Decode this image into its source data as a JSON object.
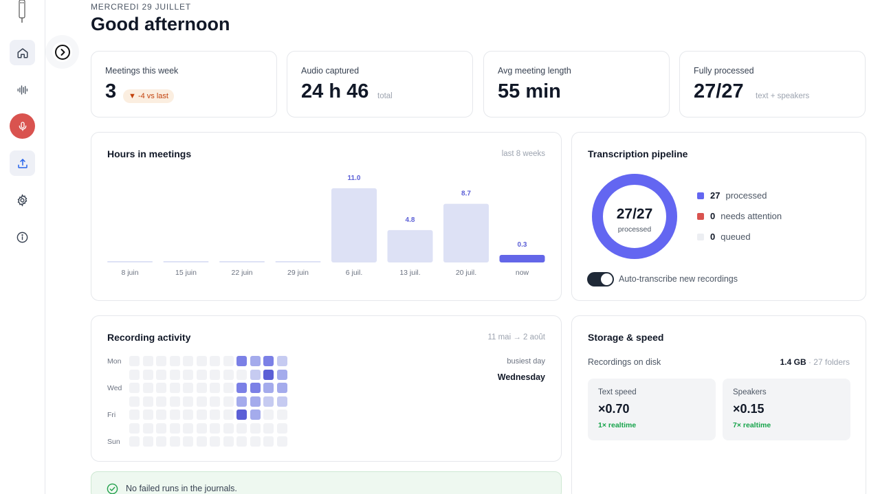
{
  "header": {
    "date": "MERCREDI 29 JUILLET",
    "greeting": "Good afternoon"
  },
  "sidebar": {
    "items": [
      {
        "icon": "home-icon"
      },
      {
        "icon": "waveform-icon"
      },
      {
        "icon": "microphone-icon"
      },
      {
        "icon": "upload-icon"
      },
      {
        "icon": "gear-icon"
      },
      {
        "icon": "info-icon"
      }
    ]
  },
  "stats": [
    {
      "label": "Meetings this week",
      "value": "3",
      "badge": "▼ -4 vs last"
    },
    {
      "label": "Audio captured",
      "value": "24 h 46",
      "sub": "total"
    },
    {
      "label": "Avg meeting length",
      "value": "55 min"
    },
    {
      "label": "Fully processed",
      "value": "27/27",
      "sub": "text + speakers"
    }
  ],
  "hours": {
    "title": "Hours in meetings",
    "note": "last 8 weeks",
    "chart_data": {
      "type": "bar",
      "categories": [
        "8 juin",
        "15 juin",
        "22 juin",
        "29 juin",
        "6 juil.",
        "13 juil.",
        "20 juil.",
        "now"
      ],
      "values": [
        0,
        0,
        0,
        0,
        11.0,
        4.8,
        8.7,
        0.3
      ],
      "labels": [
        "",
        "",
        "",
        "",
        "11.0",
        "4.8",
        "8.7",
        "0.3"
      ],
      "highlight_index": 7,
      "colors": {
        "bar": "#dde1f5",
        "current": "#6366e8",
        "label": "#5b5fd6"
      }
    }
  },
  "pipeline": {
    "title": "Transcription pipeline",
    "center_value": "27/27",
    "center_label": "processed",
    "processed_fraction": 1.0,
    "legend": [
      {
        "count": "27",
        "label": "processed",
        "color": "#6366f1"
      },
      {
        "count": "0",
        "label": "needs attention",
        "color": "#d9534f"
      },
      {
        "count": "0",
        "label": "queued",
        "color": "#e5e7eb"
      }
    ],
    "toggle_on": true,
    "toggle_label": "Auto-transcribe new recordings"
  },
  "activity": {
    "title": "Recording activity",
    "range": "11 mai → 2 août",
    "row_labels": [
      "Mon",
      "",
      "Wed",
      "",
      "Fri",
      "",
      "Sun"
    ],
    "busiest_label": "busiest day",
    "busiest_value": "Wednesday",
    "grid": [
      [
        0,
        0,
        0,
        0,
        0,
        0,
        0,
        0,
        3,
        2,
        3,
        1
      ],
      [
        0,
        0,
        0,
        0,
        0,
        0,
        0,
        0,
        0,
        1,
        4,
        2
      ],
      [
        0,
        0,
        0,
        0,
        0,
        0,
        0,
        0,
        3,
        3,
        2,
        2
      ],
      [
        0,
        0,
        0,
        0,
        0,
        0,
        0,
        0,
        2,
        2,
        1,
        1
      ],
      [
        0,
        0,
        0,
        0,
        0,
        0,
        0,
        0,
        4,
        2,
        0,
        0
      ],
      [
        0,
        0,
        0,
        0,
        0,
        0,
        0,
        0,
        0,
        0,
        0,
        0
      ],
      [
        0,
        0,
        0,
        0,
        0,
        0,
        0,
        0,
        0,
        0,
        0,
        0
      ]
    ],
    "levels": [
      "#f1f2f5",
      "#c6cbf1",
      "#a4abec",
      "#7b80e6",
      "#5b5fd6"
    ]
  },
  "storage": {
    "title": "Storage & speed",
    "disk_label": "Recordings on disk",
    "disk_value": "1.4 GB",
    "disk_sub": "· 27 folders",
    "text_speed": {
      "label": "Text speed",
      "value": "×0.70",
      "note": "1× realtime"
    },
    "speakers_speed": {
      "label": "Speakers",
      "value": "×0.15",
      "note": "7× realtime"
    }
  },
  "banner": {
    "text": "No failed runs in the journals."
  }
}
